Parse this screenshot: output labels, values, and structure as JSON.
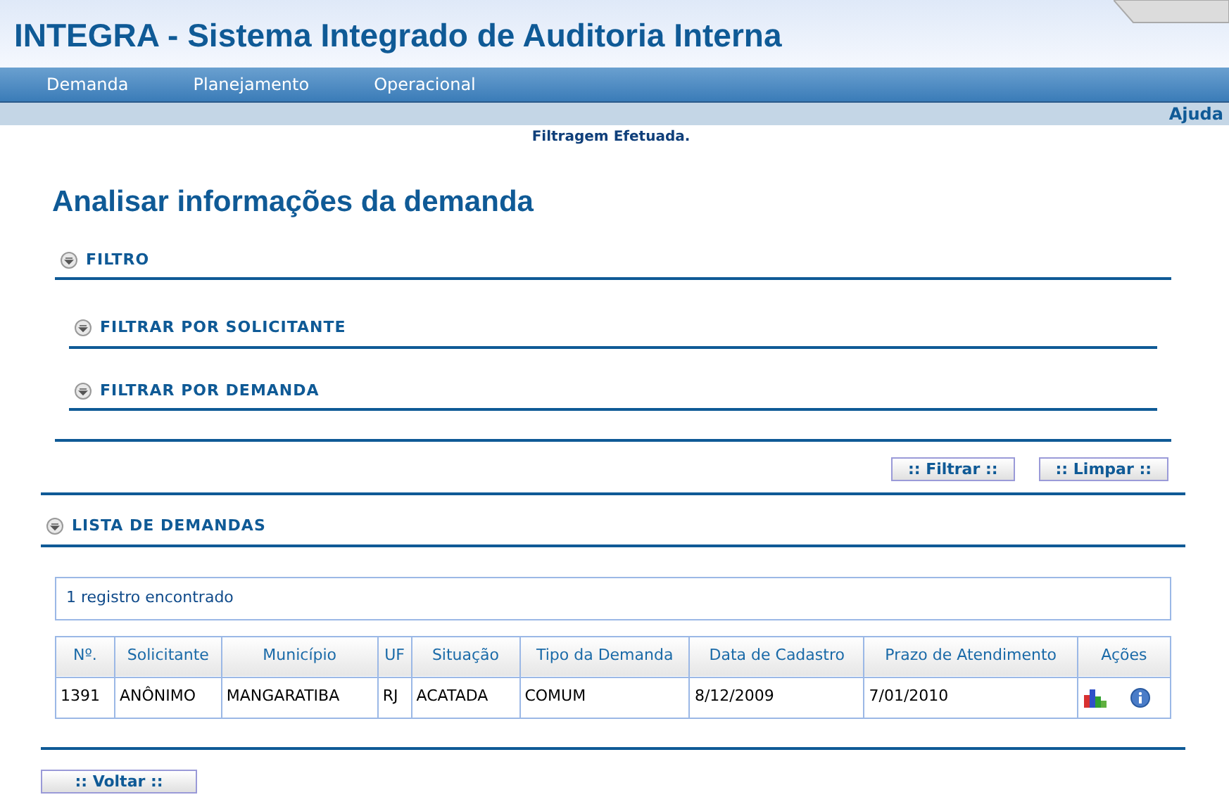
{
  "header": {
    "title": "INTEGRA - Sistema Integrado de Auditoria Interna"
  },
  "menu": [
    {
      "label": "Demanda"
    },
    {
      "label": "Planejamento"
    },
    {
      "label": "Operacional"
    }
  ],
  "help_link": "Ajuda",
  "message": "Filtragem Efetuada.",
  "page_title": "Analisar informações da demanda",
  "filter": {
    "title": "FILTRO",
    "expanded": true,
    "subsections": [
      {
        "title": "FILTRAR POR SOLICITANTE"
      },
      {
        "title": "FILTRAR POR DEMANDA"
      }
    ],
    "buttons": [
      ":: Filtrar ::",
      ":: Limpar ::"
    ]
  },
  "list": {
    "title": "LISTA DE DEMANDAS",
    "count": "1 registro encontrado",
    "columns": [
      "Nº.",
      "Solicitante",
      "Município",
      "UF",
      "Situação",
      "Tipo da Demanda",
      "Data de Cadastro",
      "Prazo de Atendimento",
      "Ações"
    ],
    "rows": [
      {
        "cells": [
          "1391",
          "ANÔNIMO",
          "MANGARATIBA",
          "RJ",
          "ACATADA",
          "COMUM",
          "8/12/2009",
          "7/01/2010"
        ]
      }
    ]
  },
  "back_button": ":: Voltar ::"
}
